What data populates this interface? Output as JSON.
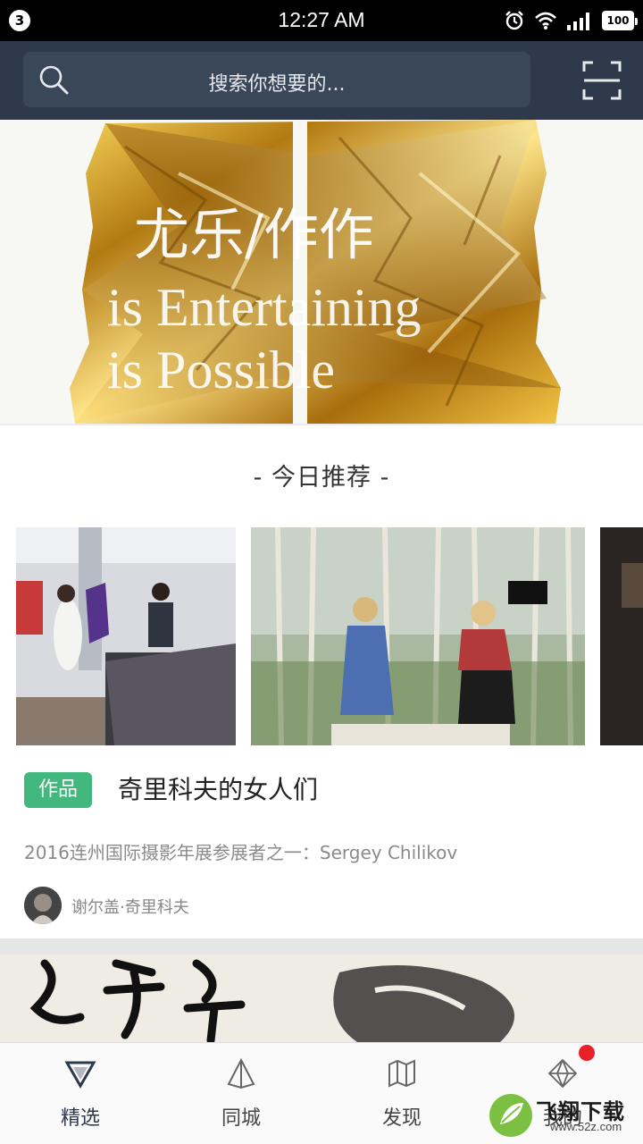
{
  "status_bar": {
    "notification_count": "3",
    "time": "12:27 AM",
    "battery": "100"
  },
  "search": {
    "placeholder": "搜索你想要的..."
  },
  "banner": {
    "text_cn": "尤乐/作作",
    "text_en_line1": "is Entertaining",
    "text_en_line2": "is Possible"
  },
  "section": {
    "title": "- 今日推荐 -"
  },
  "work": {
    "tag": "作品",
    "title": "奇里科夫的女人们",
    "description": "2016连州国际摄影年展参展者之一：Sergey Chilikov",
    "author": "谢尔盖·奇里科夫"
  },
  "tabs": [
    {
      "label": "精选",
      "icon": "triangle-down-icon",
      "active": true
    },
    {
      "label": "同城",
      "icon": "pyramid-icon",
      "active": false
    },
    {
      "label": "发现",
      "icon": "map-icon",
      "active": false
    },
    {
      "label": "我的",
      "icon": "diamond-icon",
      "active": false
    }
  ],
  "watermark": {
    "name": "飞翔下载",
    "url": "www.52z.com"
  },
  "colors": {
    "header": "#2e3a4c",
    "accent_green": "#42b77e",
    "badge_red": "#e8202a"
  }
}
